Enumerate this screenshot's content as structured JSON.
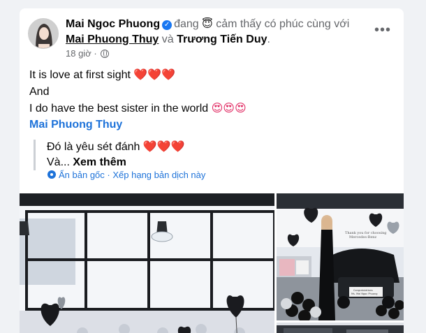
{
  "post": {
    "author": "Mai Ngoc Phuong",
    "activity_prefix": "đang",
    "activity_emoji": "😇",
    "activity_text": "cảm thấy có phúc cùng với",
    "tagged_1": "Mai Phuong Thuy",
    "and_word": "và",
    "tagged_2": "Trương Tiến Duy",
    "period": ".",
    "time": "18 giờ",
    "dot": "·",
    "more_label": "•••",
    "lines": [
      "It is love at first sight",
      "And",
      "I do have the best sister in the world"
    ],
    "hearts": "❤️❤️❤️",
    "heart_eyes": "😍😍😍"
  },
  "quote": {
    "author": "Mai Phuong Thuy",
    "line1": "Đó là yêu sét đánh",
    "hearts": "❤️❤️❤️",
    "line2_prefix": "Và...",
    "see_more": "Xem thêm"
  },
  "translation": {
    "hide_original": "Ẩn bản gốc",
    "separator": "·",
    "rate": "Xếp hạng bản dịch này"
  },
  "photos": {
    "banner_line1": "Thank you for choosing",
    "banner_line2": "Mercedes-Benz",
    "plate_small": "Congratulations",
    "plate_name": "Ms. Mai Ngoc Phuong"
  },
  "colors": {
    "link_blue": "#1d72d9",
    "verified_blue": "#1877f2",
    "muted": "#65676b"
  }
}
